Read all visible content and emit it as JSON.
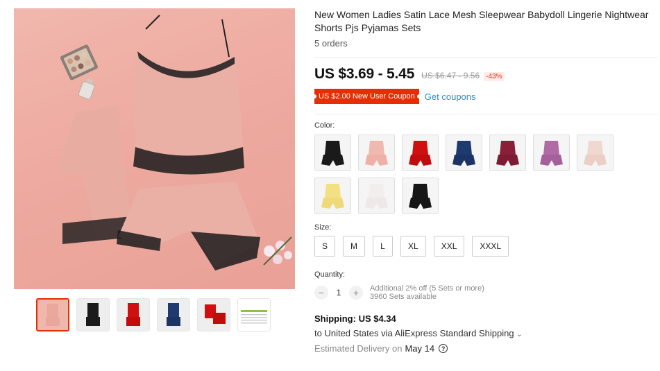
{
  "product": {
    "title": "New Women Ladies Satin Lace Mesh Sleepwear Babydoll Lingerie Nightwear Shorts Pjs Pyjamas Sets",
    "orders": "5 orders",
    "price": "US $3.69 - 5.45",
    "old_price": "US $6.47 - 9.56",
    "discount": "-43%"
  },
  "coupon": {
    "label": "US $2.00 New User Coupon",
    "link": "Get coupons"
  },
  "color": {
    "label": "Color:",
    "swatches": [
      {
        "name": "black",
        "top": "#1a1a1a",
        "bottom": "#1a1a1a"
      },
      {
        "name": "pink",
        "top": "#f0b9b0",
        "bottom": "#efb0a6"
      },
      {
        "name": "red",
        "top": "#d01010",
        "bottom": "#c00c0c"
      },
      {
        "name": "navy",
        "top": "#1f3a6e",
        "bottom": "#1c3465"
      },
      {
        "name": "wine-red",
        "top": "#8a1f3a",
        "bottom": "#7d1b34"
      },
      {
        "name": "purple",
        "top": "#b06aa6",
        "bottom": "#a5609b"
      },
      {
        "name": "beige",
        "top": "#f0d7d0",
        "bottom": "#ebcfc7"
      },
      {
        "name": "yellow",
        "top": "#f3e083",
        "bottom": "#efd978"
      },
      {
        "name": "white",
        "top": "#f3eeee",
        "bottom": "#eee8e8"
      },
      {
        "name": "black-2",
        "top": "#161616",
        "bottom": "#161616"
      }
    ]
  },
  "size": {
    "label": "Size:",
    "options": [
      "S",
      "M",
      "L",
      "XL",
      "XXL",
      "XXXL"
    ]
  },
  "quantity": {
    "label": "Quantity:",
    "value": "1",
    "minus": "−",
    "plus": "+",
    "additional": "Additional 2% off (5 Sets or more)",
    "available": "3960 Sets available"
  },
  "shipping": {
    "label": "Shipping:",
    "price": "US $4.34",
    "route": "to United States via AliExpress Standard Shipping",
    "delivery_label": "Estimated Delivery on",
    "delivery_date": "May 14",
    "help_icon": "?"
  },
  "gallery": {
    "thumbs": [
      "pink",
      "black",
      "red",
      "navy",
      "red-2",
      "size-chart"
    ]
  }
}
